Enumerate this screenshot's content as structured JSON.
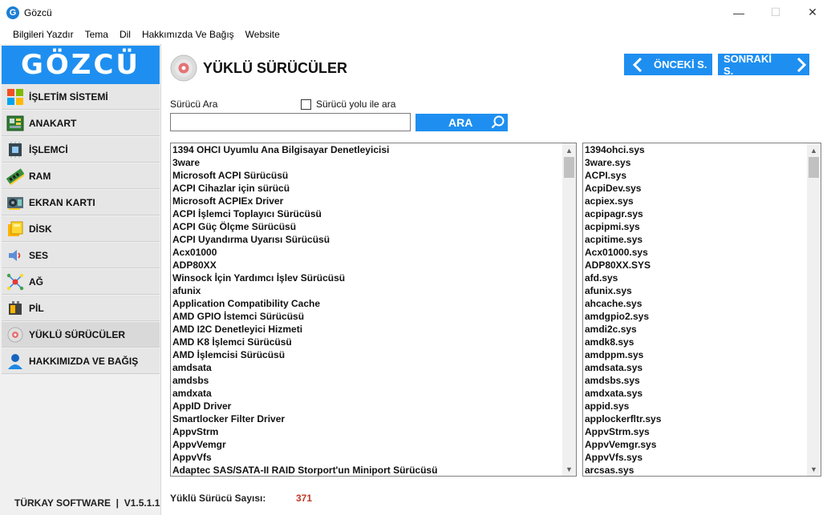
{
  "window": {
    "title": "Gözcü",
    "app_icon_letter": "G",
    "controls": {
      "minimize": "—",
      "maximize": "☐",
      "close": "✕"
    }
  },
  "menu": [
    "Bilgileri Yazdır",
    "Tema",
    "Dil",
    "Hakkımızda Ve Bağış",
    "Website"
  ],
  "sidebar": {
    "logo": "GÖZCÜ",
    "items": [
      {
        "label": "İŞLETİM SİSTEMİ",
        "icon": "windows-icon"
      },
      {
        "label": "ANAKART",
        "icon": "motherboard-icon"
      },
      {
        "label": "İŞLEMCİ",
        "icon": "cpu-icon"
      },
      {
        "label": "RAM",
        "icon": "ram-icon"
      },
      {
        "label": "EKRAN KARTI",
        "icon": "gpu-icon"
      },
      {
        "label": "DİSK",
        "icon": "disk-icon"
      },
      {
        "label": "SES",
        "icon": "speaker-icon"
      },
      {
        "label": "AĞ",
        "icon": "network-icon"
      },
      {
        "label": "PİL",
        "icon": "battery-icon"
      },
      {
        "label": "YÜKLÜ SÜRÜCÜLER",
        "icon": "driver-disc-icon",
        "active": true
      },
      {
        "label": "HAKKIMIZDA VE BAĞIŞ",
        "icon": "user-icon"
      }
    ],
    "footer": "TÜRKAY SOFTWARE  |  V1.5.1.1"
  },
  "page": {
    "title": "YÜKLÜ SÜRÜCÜLER",
    "prev_label": "ÖNCEKİ S.",
    "next_label": "SONRAKİ S."
  },
  "search": {
    "label": "Sürücü Ara",
    "checkbox_label": "Sürücü yolu ile ara",
    "checkbox_checked": false,
    "value": "",
    "button_label": "ARA"
  },
  "drivers": {
    "names": [
      "1394 OHCI Uyumlu Ana Bilgisayar Denetleyicisi",
      "3ware",
      "Microsoft ACPI Sürücüsü",
      "ACPI Cihazlar için sürücü",
      "Microsoft ACPIEx Driver",
      "ACPI İşlemci Toplayıcı Sürücüsü",
      "ACPI Güç Ölçme Sürücüsü",
      "ACPI Uyandırma Uyarısı Sürücüsü",
      "Acx01000",
      "ADP80XX",
      "Winsock İçin Yardımcı İşlev Sürücüsü",
      "afunix",
      "Application Compatibility Cache",
      "AMD GPIO İstemci Sürücüsü",
      "AMD I2C Denetleyici Hizmeti",
      "AMD K8 İşlemci Sürücüsü",
      "AMD İşlemcisi Sürücüsü",
      "amdsata",
      "amdsbs",
      "amdxata",
      "AppID Driver",
      "Smartlocker Filter Driver",
      "AppvStrm",
      "AppvVemgr",
      "AppvVfs",
      "Adaptec SAS/SATA-II RAID Storport'un Miniport Sürücüsü"
    ],
    "files": [
      "1394ohci.sys",
      "3ware.sys",
      "ACPI.sys",
      "AcpiDev.sys",
      "acpiex.sys",
      "acpipagr.sys",
      "acpipmi.sys",
      "acpitime.sys",
      "Acx01000.sys",
      "ADP80XX.SYS",
      "afd.sys",
      "afunix.sys",
      "ahcache.sys",
      "amdgpio2.sys",
      "amdi2c.sys",
      "amdk8.sys",
      "amdppm.sys",
      "amdsata.sys",
      "amdsbs.sys",
      "amdxata.sys",
      "appid.sys",
      "applockerfltr.sys",
      "AppvStrm.sys",
      "AppvVemgr.sys",
      "AppvVfs.sys",
      "arcsas.sys"
    ]
  },
  "count": {
    "label": "Yüklü Sürücü Sayısı:",
    "value": "371"
  },
  "colors": {
    "accent": "#1e8ff0",
    "count_value": "#c0392b",
    "sidebar_bg": "#f0f0f0"
  }
}
